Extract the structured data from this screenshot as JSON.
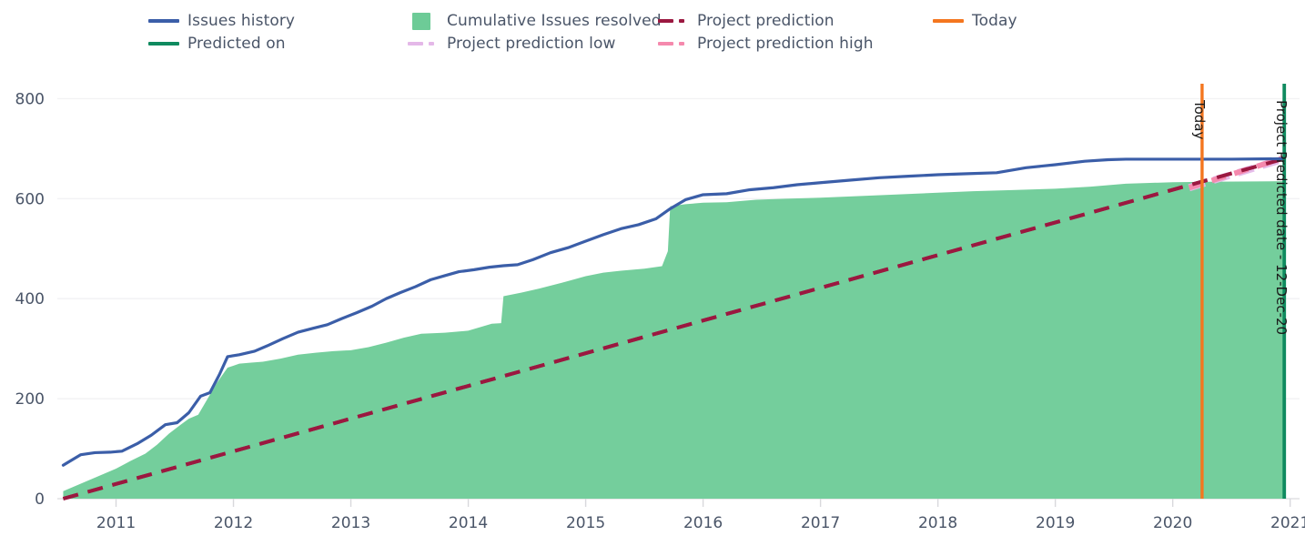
{
  "legend": {
    "items": [
      {
        "label": "Issues history",
        "marker": "solid-line",
        "color": "#3b5ea8",
        "col": 0,
        "row": 0
      },
      {
        "label": "Cumulative Issues resolved",
        "marker": "area-swatch",
        "color": "#6dcb97",
        "col": 1,
        "row": 0
      },
      {
        "label": "Project prediction",
        "marker": "dashed-line",
        "color": "#9b1840",
        "col": 2,
        "row": 0
      },
      {
        "label": "Today",
        "marker": "solid-line",
        "color": "#f4761f",
        "col": 3,
        "row": 0
      },
      {
        "label": "Predicted on",
        "marker": "solid-line",
        "color": "#0f8a5f",
        "col": 0,
        "row": 1
      },
      {
        "label": "Project prediction low",
        "marker": "dashed-line",
        "color": "#e4b8e8",
        "col": 1,
        "row": 1
      },
      {
        "label": "Project prediction high",
        "marker": "dashed-line",
        "color": "#f589ad",
        "col": 2,
        "row": 1
      }
    ]
  },
  "annotations": {
    "today_label": "Today",
    "predicted_label": "Project Predicted date - 12-Dec-20"
  },
  "chart_data": {
    "type": "area",
    "title": "",
    "xlabel": "",
    "ylabel": "",
    "xlim": [
      2010.5,
      2021.08
    ],
    "ylim": [
      0,
      830
    ],
    "grid": true,
    "legend_position": "top",
    "yticks": [
      0,
      200,
      400,
      600,
      800
    ],
    "xticks": [
      2011,
      2012,
      2013,
      2014,
      2015,
      2016,
      2017,
      2018,
      2019,
      2020,
      2021
    ],
    "vertical_lines": [
      {
        "name": "Today",
        "x": 2020.25,
        "color": "#f4761f",
        "label": "Today"
      },
      {
        "name": "Predicted on",
        "x": 2020.95,
        "color": "#0f8a5f",
        "label": "Project Predicted date - 12-Dec-20"
      }
    ],
    "series": [
      {
        "name": "Issues history",
        "type": "line",
        "color": "#3b5ea8",
        "style": "solid",
        "x": [
          2010.55,
          2010.7,
          2010.82,
          2010.95,
          2011.05,
          2011.18,
          2011.3,
          2011.42,
          2011.52,
          2011.62,
          2011.72,
          2011.8,
          2011.88,
          2011.95,
          2012.05,
          2012.18,
          2012.3,
          2012.42,
          2012.55,
          2012.68,
          2012.8,
          2012.92,
          2013.05,
          2013.18,
          2013.3,
          2013.42,
          2013.55,
          2013.68,
          2013.8,
          2013.92,
          2014.05,
          2014.18,
          2014.3,
          2014.42,
          2014.55,
          2014.7,
          2014.85,
          2015.0,
          2015.15,
          2015.3,
          2015.45,
          2015.6,
          2015.72,
          2015.85,
          2016.0,
          2016.2,
          2016.4,
          2016.6,
          2016.8,
          2017.0,
          2017.25,
          2017.5,
          2017.75,
          2018.0,
          2018.25,
          2018.5,
          2018.75,
          2019.0,
          2019.25,
          2019.45,
          2019.6,
          2020.0,
          2020.5,
          2020.95
        ],
        "y": [
          67,
          88,
          92,
          93,
          95,
          110,
          127,
          148,
          152,
          172,
          205,
          212,
          248,
          284,
          288,
          295,
          307,
          320,
          333,
          341,
          348,
          360,
          372,
          385,
          400,
          412,
          424,
          438,
          446,
          454,
          458,
          463,
          466,
          468,
          478,
          492,
          502,
          515,
          528,
          540,
          548,
          560,
          580,
          598,
          608,
          610,
          618,
          622,
          628,
          632,
          637,
          642,
          645,
          648,
          650,
          652,
          662,
          668,
          675,
          678,
          679,
          679,
          679,
          680
        ]
      },
      {
        "name": "Cumulative Issues resolved",
        "type": "area",
        "color": "#6dcb97",
        "x": [
          2010.55,
          2010.7,
          2010.85,
          2011.0,
          2011.12,
          2011.25,
          2011.35,
          2011.45,
          2011.55,
          2011.62,
          2011.7,
          2011.78,
          2011.86,
          2011.95,
          2012.05,
          2012.15,
          2012.25,
          2012.4,
          2012.55,
          2012.7,
          2012.85,
          2013.0,
          2013.15,
          2013.3,
          2013.45,
          2013.6,
          2013.8,
          2014.0,
          2014.2,
          2014.28,
          2014.3,
          2014.45,
          2014.6,
          2014.8,
          2015.0,
          2015.15,
          2015.3,
          2015.5,
          2015.65,
          2015.7,
          2015.72,
          2015.85,
          2016.0,
          2016.2,
          2016.45,
          2016.7,
          2017.0,
          2017.3,
          2017.6,
          2018.0,
          2018.3,
          2018.6,
          2019.0,
          2019.3,
          2019.6,
          2020.0,
          2020.4,
          2020.95
        ],
        "y": [
          15,
          30,
          45,
          60,
          75,
          90,
          108,
          130,
          148,
          160,
          168,
          200,
          232,
          262,
          270,
          272,
          274,
          280,
          288,
          292,
          295,
          297,
          303,
          312,
          322,
          330,
          332,
          336,
          350,
          351,
          405,
          412,
          420,
          432,
          445,
          452,
          456,
          460,
          465,
          495,
          585,
          589,
          592,
          593,
          598,
          600,
          602,
          605,
          608,
          612,
          615,
          617,
          620,
          624,
          630,
          633,
          634,
          635
        ]
      },
      {
        "name": "Project prediction",
        "type": "line",
        "color": "#9b1840",
        "style": "dashed",
        "x": [
          2010.55,
          2020.95
        ],
        "y": [
          0,
          680
        ]
      },
      {
        "name": "Project prediction low",
        "type": "line",
        "color": "#e4b8e8",
        "style": "dashed",
        "x": [
          2020.14,
          2020.95
        ],
        "y": [
          622,
          680
        ]
      },
      {
        "name": "Project prediction high",
        "type": "line",
        "color": "#f589ad",
        "style": "dashed",
        "x": [
          2020.14,
          2020.95
        ],
        "y": [
          622,
          682
        ]
      }
    ]
  }
}
